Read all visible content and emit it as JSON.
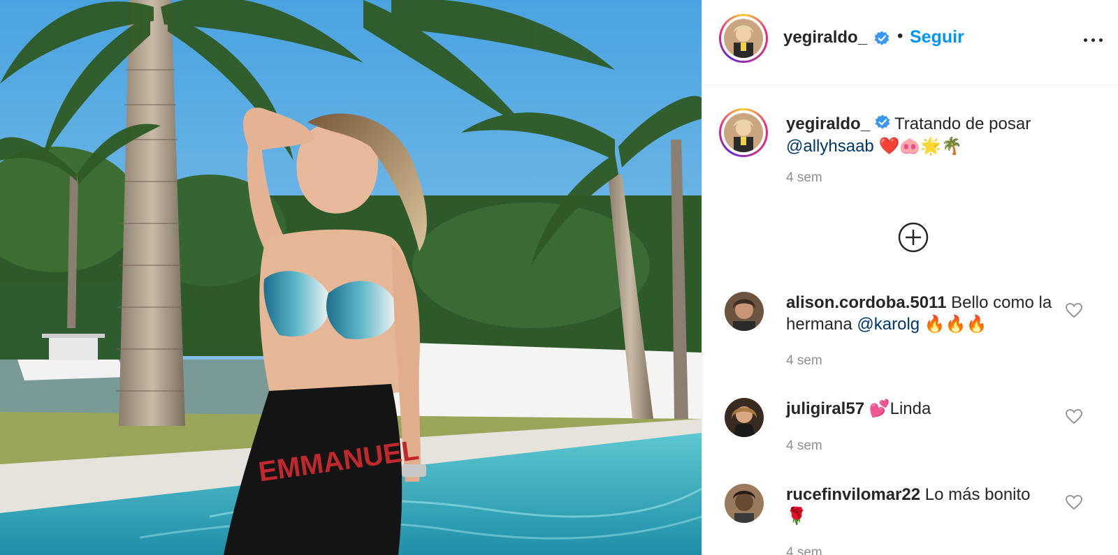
{
  "post": {
    "username": "yegiraldo_",
    "verified": true,
    "follow_label": "Seguir",
    "separator": "•",
    "more_icon": "more-horizontal-icon",
    "caption": {
      "username": "yegiraldo_",
      "text_before": "Tratando de posar",
      "mention": "@allyhsaab",
      "emojis": "❤️🐽🌟🌴",
      "time": "4 sem"
    },
    "load_more_icon": "plus-circle-icon",
    "comments": [
      {
        "username": "alison.cordoba.5011",
        "text": "Bello como la hermana",
        "mention": "@karolg",
        "emojis": "🔥🔥🔥",
        "time": "4 sem"
      },
      {
        "username": "juligiral57",
        "text": "💕Linda",
        "mention": "",
        "emojis": "",
        "time": "4 sem"
      },
      {
        "username": "rucefinvilomar22",
        "text": "Lo más bonito",
        "mention": "",
        "emojis": "🌹",
        "time": "4 sem"
      }
    ]
  },
  "colors": {
    "link_blue": "#0095f6",
    "mention_blue": "#00376b",
    "muted_gray": "#8e8e8e",
    "verified_blue": "#3897f0"
  }
}
